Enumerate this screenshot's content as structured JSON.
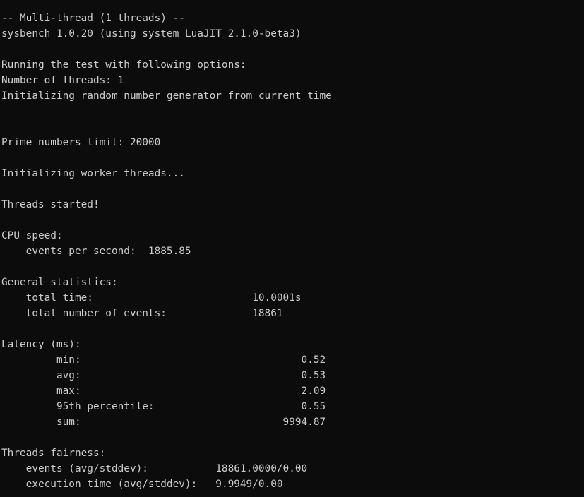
{
  "terminal": {
    "lines": [
      "-- Multi-thread (1 threads) --",
      "sysbench 1.0.20 (using system LuaJIT 2.1.0-beta3)",
      "",
      "Running the test with following options:",
      "Number of threads: 1",
      "Initializing random number generator from current time",
      "",
      "",
      "Prime numbers limit: 20000",
      "",
      "Initializing worker threads...",
      "",
      "Threads started!",
      "",
      "CPU speed:",
      "    events per second:  1885.85",
      "",
      "General statistics:",
      "    total time:                          10.0001s",
      "    total number of events:              18861",
      "",
      "Latency (ms):",
      "         min:                                    0.52",
      "         avg:                                    0.53",
      "         max:                                    2.09",
      "         95th percentile:                        0.55",
      "         sum:                                 9994.87",
      "",
      "Threads fairness:",
      "    events (avg/stddev):           18861.0000/0.00",
      "    execution time (avg/stddev):   9.9949/0.00"
    ]
  },
  "colors": {
    "background": "#0c0c0c",
    "foreground": "#cccccc"
  }
}
